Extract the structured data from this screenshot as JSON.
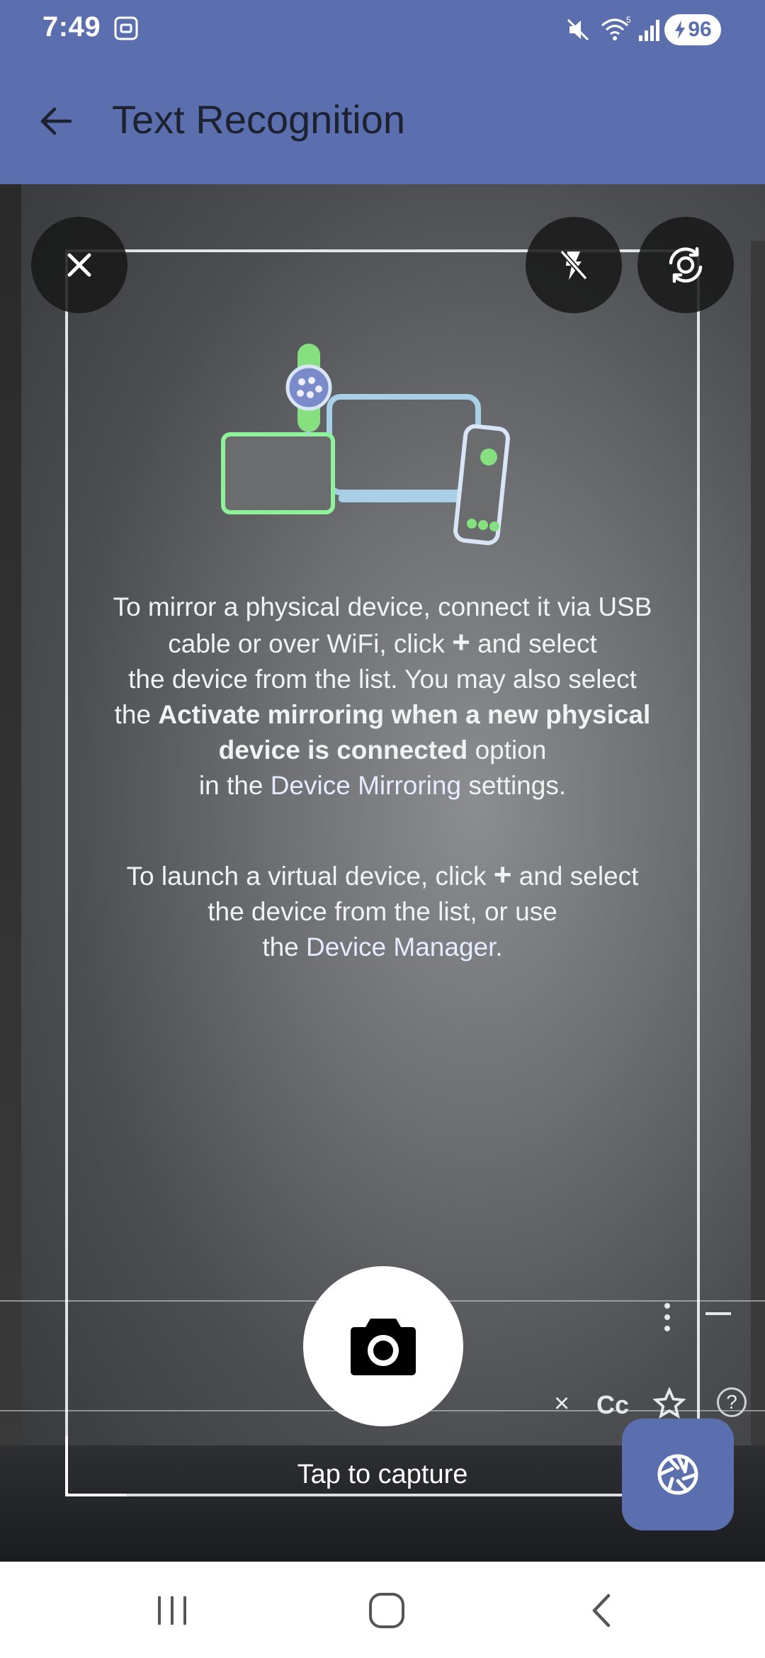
{
  "status_bar": {
    "time": "7:49",
    "battery_level": "96",
    "icons": [
      "screenshot-icon",
      "mute-icon",
      "wifi-icon",
      "signal-icon",
      "battery-charging-icon"
    ]
  },
  "app_bar": {
    "title": "Text Recognition",
    "back_icon": "arrow-left-icon"
  },
  "camera": {
    "controls": {
      "close_icon": "close-icon",
      "flash_icon": "flash-off-icon",
      "switch_camera_icon": "camera-switch-icon"
    },
    "screen_text": {
      "p1_l1": "To mirror a physical device, connect it via USB",
      "p1_l2a": "cable or over WiFi, click",
      "p1_l2b": "and select",
      "p1_l3": "the device from the list. You may also select",
      "p1_l4a": "the",
      "p1_l4b": "Activate mirroring when a new physical",
      "p1_l5a": "device is connected",
      "p1_l5b": "option",
      "p1_l6a": "in the",
      "p1_l6b": "Device Mirroring",
      "p1_l6c": "settings.",
      "p2_l1a": "To launch a virtual device, click",
      "p2_l1b": "and select",
      "p2_l2": "the device from the list, or use",
      "p2_l3a": "the",
      "p2_l3b": "Device Manager",
      "p2_l3c": ".",
      "plus": "+",
      "toolbar_close": "×",
      "toolbar_cc": "Cc",
      "toolbar_help": "?"
    },
    "capture_icon": "camera-icon",
    "capture_label": "Tap to capture",
    "fab_icon": "aperture-icon"
  },
  "nav_bar": {
    "recents_icon": "recents-icon",
    "home_icon": "home-icon",
    "back_icon": "back-chevron-icon"
  },
  "colors": {
    "primary": "#5b6fae",
    "title_text": "#1e2230"
  }
}
